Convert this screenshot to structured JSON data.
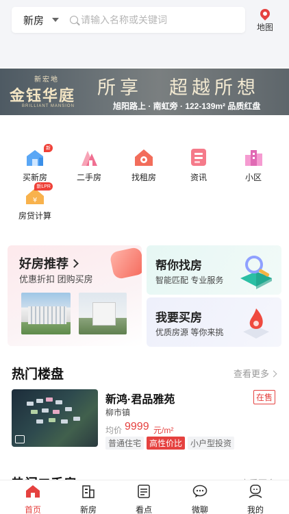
{
  "header": {
    "city": "新房",
    "search_placeholder": "请输入名称或关键词",
    "map_label": "地图"
  },
  "banner": {
    "brand_top": "新宏地",
    "brand": "金钰华庭",
    "brand_en": "BRILLIANT MANSION",
    "slogan_a": "所享",
    "slogan_b": "超越所想",
    "subline": "旭阳路上 · 南虹旁 · 122-139m² 品质红盘"
  },
  "quick_nav": [
    {
      "label": "买新房",
      "badge": "新"
    },
    {
      "label": "二手房",
      "badge": ""
    },
    {
      "label": "找租房",
      "badge": ""
    },
    {
      "label": "资讯",
      "badge": ""
    },
    {
      "label": "小区",
      "badge": ""
    },
    {
      "label": "房贷计算",
      "badge": "新LPR"
    }
  ],
  "promo": {
    "recommend": {
      "title": "好房推荐",
      "subtitle": "优惠折扣  团购买房"
    },
    "find": {
      "title": "帮你找房",
      "subtitle": "智能匹配  专业服务"
    },
    "buy": {
      "title": "我要买房",
      "subtitle": "优质房源  等你来挑"
    }
  },
  "hot_estates": {
    "title": "热门楼盘",
    "more": "查看更多",
    "items": [
      {
        "name": "新鸿·君品雅苑",
        "location": "柳市镇",
        "status": "在售",
        "price_label": "均价",
        "price": "9999",
        "price_unit": "元/m²",
        "tags": [
          "普通住宅",
          "高性价比",
          "小户型投资"
        ]
      }
    ]
  },
  "hot_second": {
    "title": "热门二手房",
    "more": "查看更多"
  },
  "tabbar": [
    {
      "label": "首页",
      "active": true
    },
    {
      "label": "新房",
      "active": false
    },
    {
      "label": "看点",
      "active": false
    },
    {
      "label": "微聊",
      "active": false
    },
    {
      "label": "我的",
      "active": false
    }
  ],
  "colors": {
    "accent": "#e5413f",
    "banner_gold": "#f4e6c4"
  }
}
